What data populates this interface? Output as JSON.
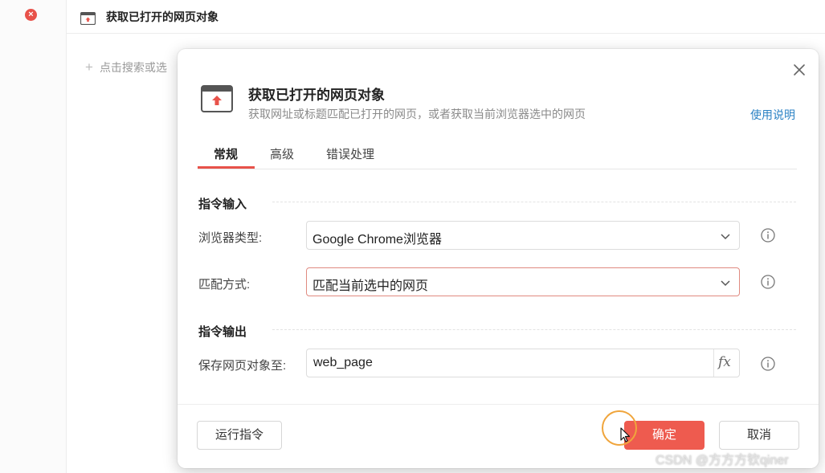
{
  "background": {
    "header_title": "获取已打开的网页对象",
    "add_text": "点击搜索或选",
    "error_icon": "close-circle-icon"
  },
  "dialog": {
    "title": "获取已打开的网页对象",
    "description": "获取网址或标题匹配已打开的网页，或者获取当前浏览器选中的网页",
    "help_link": "使用说明",
    "tabs": [
      {
        "label": "常规",
        "active": true
      },
      {
        "label": "高级",
        "active": false
      },
      {
        "label": "错误处理",
        "active": false
      }
    ],
    "input_section": {
      "title": "指令输入",
      "fields": [
        {
          "label": "浏览器类型:",
          "value": "Google Chrome浏览器"
        },
        {
          "label": "匹配方式:",
          "value": "匹配当前选中的网页"
        }
      ]
    },
    "output_section": {
      "title": "指令输出",
      "fields": [
        {
          "label": "保存网页对象至:",
          "value": "web_page",
          "fx": "fx"
        }
      ]
    },
    "buttons": {
      "run": "运行指令",
      "ok": "确定",
      "cancel": "取消"
    }
  },
  "watermark": "CSDN @方方方钦qiner",
  "colors": {
    "accent": "#ee5b4f",
    "link": "#2b82c4",
    "click_ring": "#f0a53c"
  }
}
